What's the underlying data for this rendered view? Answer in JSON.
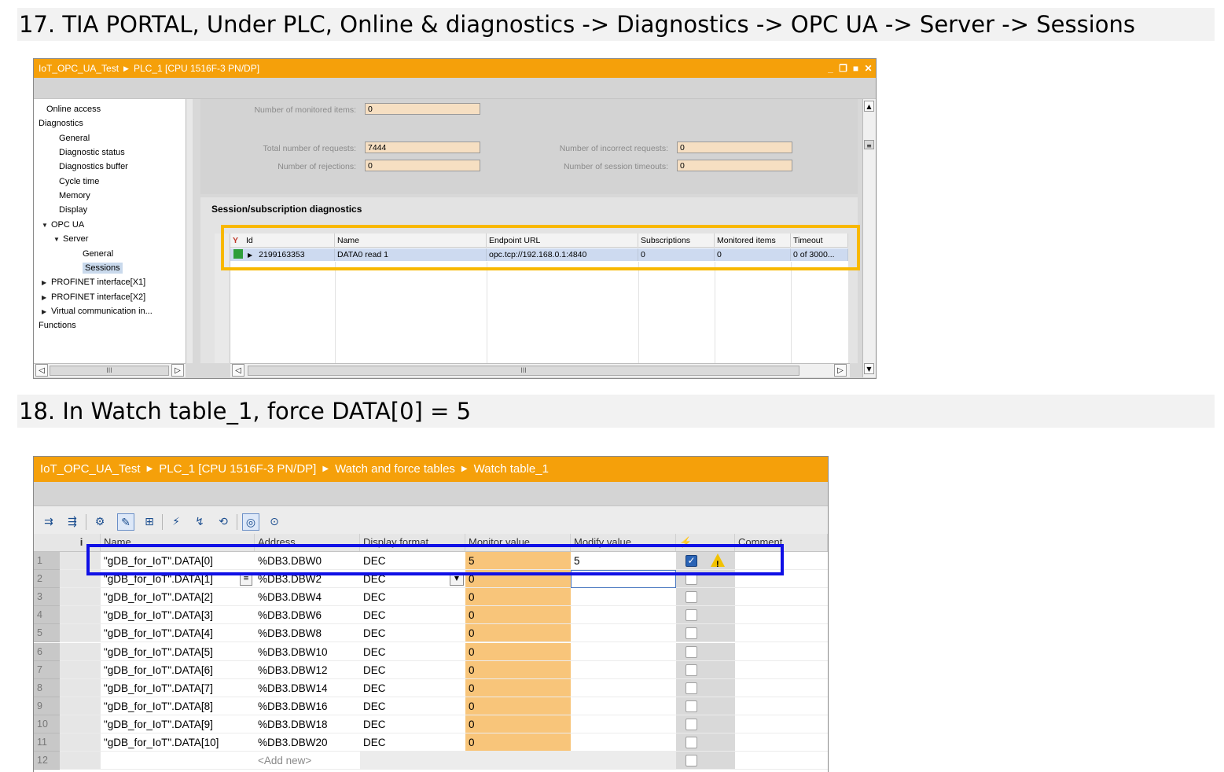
{
  "step17": {
    "heading": "17. TIA PORTAL, Under PLC, Online & diagnostics -> Diagnostics -> OPC UA -> Server -> Sessions"
  },
  "step18": {
    "heading": "18. In Watch table_1, force DATA[0] = 5"
  },
  "window1": {
    "breadcrumb": [
      "IoT_OPC_UA_Test",
      "PLC_1 [CPU 1516F-3 PN/DP]"
    ],
    "nav": [
      {
        "label": "Online access",
        "level": 0,
        "expander": "none"
      },
      {
        "label": "Diagnostics",
        "level": 0,
        "expander": "expanded"
      },
      {
        "label": "General",
        "level": 1,
        "expander": "none"
      },
      {
        "label": "Diagnostic status",
        "level": 1,
        "expander": "none"
      },
      {
        "label": "Diagnostics buffer",
        "level": 1,
        "expander": "none"
      },
      {
        "label": "Cycle time",
        "level": 1,
        "expander": "none"
      },
      {
        "label": "Memory",
        "level": 1,
        "expander": "none"
      },
      {
        "label": "Display",
        "level": 1,
        "expander": "none"
      },
      {
        "label": "OPC UA",
        "level": 1,
        "expander": "expanded"
      },
      {
        "label": "Server",
        "level": 2,
        "expander": "expanded"
      },
      {
        "label": "General",
        "level": 3,
        "expander": "none"
      },
      {
        "label": "Sessions",
        "level": 3,
        "expander": "none",
        "selected": true
      },
      {
        "label": "PROFINET interface[X1]",
        "level": 1,
        "expander": "collapsed"
      },
      {
        "label": "PROFINET interface[X2]",
        "level": 1,
        "expander": "collapsed"
      },
      {
        "label": "Virtual communication in...",
        "level": 1,
        "expander": "collapsed"
      },
      {
        "label": "Functions",
        "level": 0,
        "expander": "collapsed"
      }
    ],
    "fields": {
      "monitored_items": {
        "label": "Number of monitored items:",
        "value": "0"
      },
      "total_requests": {
        "label": "Total number of requests:",
        "value": "7444"
      },
      "rejections": {
        "label": "Number of rejections:",
        "value": "0"
      },
      "incorrect_requests": {
        "label": "Number of incorrect requests:",
        "value": "0"
      },
      "session_timeouts": {
        "label": "Number of session timeouts:",
        "value": "0"
      }
    },
    "session_section_title": "Session/subscription diagnostics",
    "session_table": {
      "columns": [
        "Id",
        "Name",
        "Endpoint URL",
        "Subscriptions",
        "Monitored items",
        "Timeout"
      ],
      "row": {
        "id": "2199163353",
        "name": "DATA0 read 1",
        "endpoint": "opc.tcp://192.168.0.1:4840",
        "subscriptions": "0",
        "monitored_items": "0",
        "timeout": "0 of 3000..."
      }
    },
    "scroll_thumb": "III",
    "highlight_color": "#f8b800"
  },
  "window2": {
    "breadcrumb": [
      "IoT_OPC_UA_Test",
      "PLC_1 [CPU 1516F-3 PN/DP]",
      "Watch and force tables",
      "Watch table_1"
    ],
    "columns": {
      "info": "i",
      "name": "Name",
      "address": "Address",
      "display_format": "Display format",
      "monitor_value": "Monitor value",
      "modify_value": "Modify value",
      "modify_flag": "⚡",
      "comment": "Comment"
    },
    "rows": [
      {
        "num": "1",
        "name": "\"gDB_for_IoT\".DATA[0]",
        "address": "%DB3.DBW0",
        "format": "DEC",
        "monitor": "5",
        "modify": "5",
        "checked": true,
        "warning": true
      },
      {
        "num": "2",
        "name": "\"gDB_for_IoT\".DATA[1]",
        "address": "%DB3.DBW2",
        "format": "DEC",
        "monitor": "0",
        "modify": "",
        "checked": false,
        "warning": false
      },
      {
        "num": "3",
        "name": "\"gDB_for_IoT\".DATA[2]",
        "address": "%DB3.DBW4",
        "format": "DEC",
        "monitor": "0",
        "modify": "",
        "checked": false,
        "warning": false
      },
      {
        "num": "4",
        "name": "\"gDB_for_IoT\".DATA[3]",
        "address": "%DB3.DBW6",
        "format": "DEC",
        "monitor": "0",
        "modify": "",
        "checked": false,
        "warning": false
      },
      {
        "num": "5",
        "name": "\"gDB_for_IoT\".DATA[4]",
        "address": "%DB3.DBW8",
        "format": "DEC",
        "monitor": "0",
        "modify": "",
        "checked": false,
        "warning": false
      },
      {
        "num": "6",
        "name": "\"gDB_for_IoT\".DATA[5]",
        "address": "%DB3.DBW10",
        "format": "DEC",
        "monitor": "0",
        "modify": "",
        "checked": false,
        "warning": false
      },
      {
        "num": "7",
        "name": "\"gDB_for_IoT\".DATA[6]",
        "address": "%DB3.DBW12",
        "format": "DEC",
        "monitor": "0",
        "modify": "",
        "checked": false,
        "warning": false
      },
      {
        "num": "8",
        "name": "\"gDB_for_IoT\".DATA[7]",
        "address": "%DB3.DBW14",
        "format": "DEC",
        "monitor": "0",
        "modify": "",
        "checked": false,
        "warning": false
      },
      {
        "num": "9",
        "name": "\"gDB_for_IoT\".DATA[8]",
        "address": "%DB3.DBW16",
        "format": "DEC",
        "monitor": "0",
        "modify": "",
        "checked": false,
        "warning": false
      },
      {
        "num": "10",
        "name": "\"gDB_for_IoT\".DATA[9]",
        "address": "%DB3.DBW18",
        "format": "DEC",
        "monitor": "0",
        "modify": "",
        "checked": false,
        "warning": false
      },
      {
        "num": "11",
        "name": "\"gDB_for_IoT\".DATA[10]",
        "address": "%DB3.DBW20",
        "format": "DEC",
        "monitor": "0",
        "modify": "",
        "checked": false,
        "warning": false
      },
      {
        "num": "12",
        "name": "",
        "address": "<Add new>",
        "format": "",
        "monitor": "",
        "modify": "",
        "checked": false,
        "warning": false
      }
    ],
    "highlight_color": "#1010e6"
  },
  "colors": {
    "titlebar": "#f5a00a",
    "monitor_cell": "#f8c57a",
    "selected_row": "#cddaf0"
  }
}
